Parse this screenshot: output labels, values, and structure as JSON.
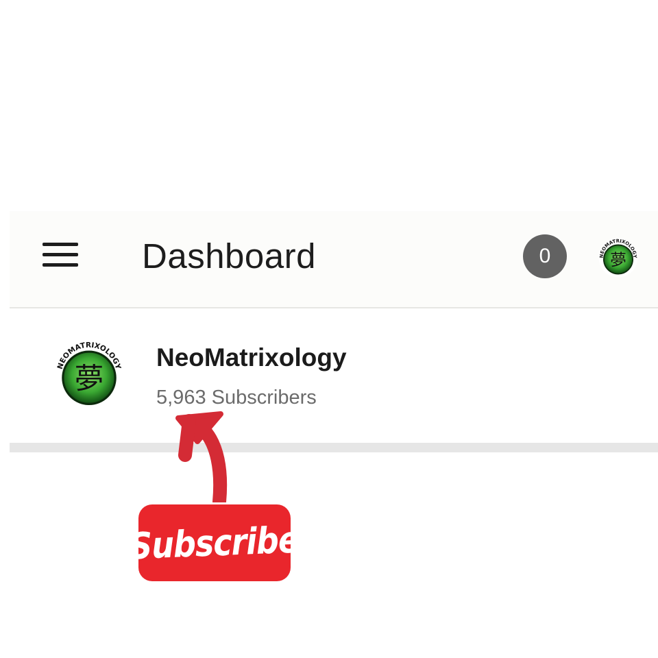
{
  "header": {
    "title": "Dashboard",
    "notification_count": "0",
    "menu_icon": "hamburger-menu-icon",
    "profile_icon": "profile-avatar-icon"
  },
  "channel": {
    "name": "NeoMatrixology",
    "subscribers": "5,963 Subscribers",
    "logo_text": "NEOMATRIXOLOGY",
    "logo_glyph": "夢",
    "logo_color": "#3aa832"
  },
  "sticker": {
    "label": "Subscribe",
    "color": "#e9262c",
    "arrow_color": "#d42b35",
    "arrow_icon": "curved-arrow-up-icon"
  }
}
